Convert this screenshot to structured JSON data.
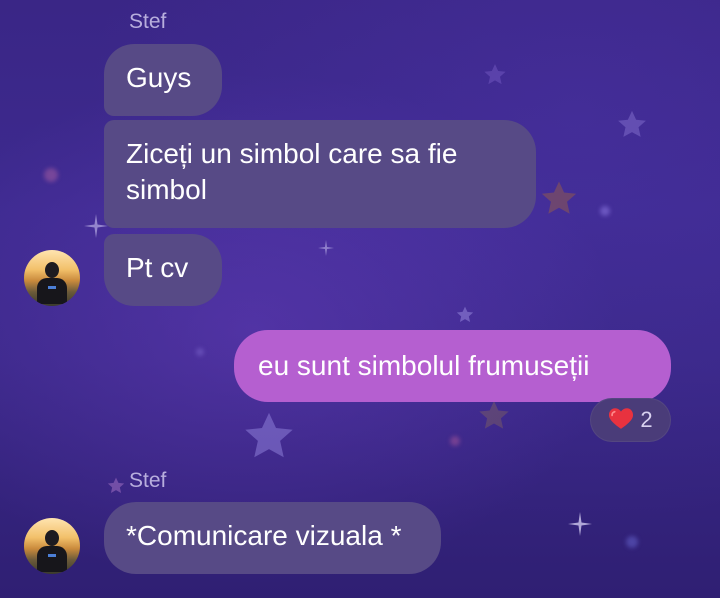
{
  "messages": [
    {
      "sender": "Stef",
      "text": "Guys",
      "direction": "incoming"
    },
    {
      "text": "Ziceți un simbol care sa fie simbol",
      "direction": "incoming"
    },
    {
      "text": "Pt cv",
      "direction": "incoming",
      "avatar": "user-avatar"
    },
    {
      "text": "eu sunt simbolul frumuseții",
      "direction": "outgoing",
      "reaction": {
        "icon": "heart-icon",
        "count": "2"
      }
    },
    {
      "sender": "Stef",
      "text": "*Comunicare vizuala *",
      "direction": "incoming",
      "avatar": "user-avatar"
    }
  ],
  "colors": {
    "incoming_bubble": "#574a86",
    "outgoing_bubble": "#b55fd0",
    "sender_name": "#b8aedd",
    "background": "#3a2686"
  }
}
